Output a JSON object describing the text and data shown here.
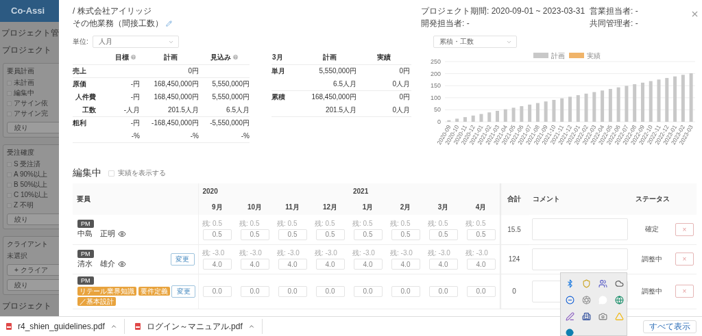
{
  "backdrop": {
    "brand": "Co-Assi",
    "breadcrumb": "プロジェクト管",
    "page_title": "プロジェクト",
    "panels": [
      {
        "title": "要員計画",
        "items": [
          {
            "label": "未計画",
            "checked": false
          },
          {
            "label": "編集中",
            "checked": false
          },
          {
            "label": "アサイン依",
            "checked": false
          },
          {
            "label": "アサイン完",
            "checked": false
          }
        ],
        "buttons": [
          "絞り"
        ]
      },
      {
        "title": "受注確度",
        "items": [
          {
            "label": "S 受注済",
            "checked": false
          },
          {
            "label": "A 90%以上",
            "checked": false
          },
          {
            "label": "B 50%以上",
            "checked": false
          },
          {
            "label": "C 10%以上",
            "checked": false
          },
          {
            "label": "Z 不明",
            "checked": false
          }
        ],
        "buttons": [
          "絞り"
        ]
      },
      {
        "title": "クライアント",
        "note": "未選択",
        "buttons": [
          "+ クライア",
          "絞り"
        ]
      }
    ],
    "footer_title": "プロジェクト"
  },
  "modal": {
    "client": "/ 株式会社アイリッジ",
    "project": "その他業務（間接工数）",
    "meta": [
      "プロジェクト期間: 2020-09-01 ~ 2023-03-31",
      "営業担当者: -",
      "開発担当者: -",
      "共同管理者: -"
    ],
    "summary": {
      "unit_label": "単位:",
      "unit": "人月",
      "columns": [
        {
          "label": "目標",
          "help": true
        },
        {
          "label": "計画",
          "help": false
        },
        {
          "label": "見込み",
          "help": true
        }
      ],
      "groups": [
        {
          "rows": [
            {
              "label": "売上",
              "plan": "0円"
            }
          ]
        },
        {
          "rows": [
            {
              "label": "原価",
              "target": "-円",
              "plan": "168,450,000円",
              "forecast": "5,550,000円",
              "children": [
                {
                  "label": "人件費",
                  "target": "-円",
                  "plan": "168,450,000円",
                  "forecast": "5,550,000円"
                },
                {
                  "label": "工数",
                  "target": "-人月",
                  "plan": "201.5人月",
                  "forecast": "6.5人月"
                }
              ]
            }
          ]
        },
        {
          "rows": [
            {
              "label": "粗利",
              "target": "-円",
              "plan": "-168,450,000円",
              "forecast": "-5,550,000円"
            },
            {
              "target": "-%",
              "plan": "-%",
              "forecast": "-%"
            }
          ]
        }
      ]
    },
    "monthly": {
      "month": "3月",
      "columns": [
        "計画",
        "実績"
      ],
      "rows": [
        {
          "label": "単月",
          "cells": [
            "5,550,000円",
            "0円"
          ]
        },
        {
          "cells": [
            "6.5人月",
            "0人月"
          ]
        },
        {
          "label": "累積",
          "cells": [
            "168,450,000円",
            "0円"
          ]
        },
        {
          "cells": [
            "201.5人月",
            "0人月"
          ]
        }
      ]
    },
    "chart": {
      "select": "累積・工数",
      "chart_data": {
        "type": "bar",
        "categories": [
          "2020-09",
          "2020-10",
          "2020-11",
          "2020-12",
          "2021-01",
          "2021-02",
          "2021-03",
          "2021-04",
          "2021-05",
          "2021-06",
          "2021-07",
          "2021-08",
          "2021-09",
          "2021-10",
          "2021-11",
          "2021-12",
          "2022-01",
          "2022-02",
          "2022-03",
          "2022-04",
          "2022-05",
          "2022-06",
          "2022-07",
          "2022-08",
          "2022-09",
          "2022-10",
          "2022-11",
          "2022-12",
          "2023-01",
          "2023-02",
          "2023-03"
        ],
        "series": [
          {
            "name": "計画",
            "color": "#c8c8c8",
            "values": [
              6.5,
              13,
              19.5,
              26,
              32.5,
              39,
              45.5,
              52,
              58.5,
              65,
              71.5,
              78,
              84.5,
              91,
              97.5,
              104,
              110.5,
              117,
              123.5,
              130,
              136.5,
              143,
              149.5,
              156,
              162.5,
              169,
              175.5,
              182,
              188.5,
              195,
              201.5
            ]
          },
          {
            "name": "実績",
            "color": "#f0b46a",
            "values": [
              0,
              0,
              0,
              0,
              0,
              0,
              0,
              0,
              0,
              0,
              0,
              0,
              0,
              0,
              0,
              0,
              0,
              0,
              0,
              0,
              0,
              0,
              0,
              0,
              0,
              0,
              0,
              0,
              0,
              0,
              0
            ]
          }
        ],
        "ylim": [
          0,
          250
        ],
        "yticks": [
          0,
          50,
          100,
          150,
          200,
          250
        ],
        "grid": true
      }
    },
    "plan": {
      "title": "編集中",
      "show_actual": {
        "label": "実績を表示する",
        "checked": false
      },
      "member_header": "要員",
      "years": [
        {
          "label": "2020",
          "months": [
            "9月",
            "10月",
            "11月",
            "12月"
          ]
        },
        {
          "label": "2021",
          "months": [
            "1月",
            "2月",
            "3月",
            "4月"
          ]
        }
      ],
      "total_header": "合計",
      "comment_header": "コメント",
      "status_header": "ステータス",
      "rows": [
        {
          "role": "PM",
          "name": "中島　正明",
          "watching": true,
          "remaining": [
            "残: 0.5",
            "残: 0.5",
            "残: 0.5",
            "残: 0.5",
            "残: 0.5",
            "残: 0.5",
            "残: 0.5",
            "残: 0.5"
          ],
          "values": [
            "0.5",
            "0.5",
            "0.5",
            "0.5",
            "0.5",
            "0.5",
            "0.5",
            "0.5"
          ],
          "total": "15.5",
          "status": "確定",
          "delete": "×"
        },
        {
          "role": "PM",
          "name": "清水　雄介",
          "watching": true,
          "change": "変更",
          "remaining": [
            "残: -3.0",
            "残: -3.0",
            "残: -3.0",
            "残: -3.0",
            "残: -3.0",
            "残: -3.0",
            "残: -3.0",
            "残: -3.0"
          ],
          "values": [
            "4.0",
            "4.0",
            "4.0",
            "4.0",
            "4.0",
            "4.0",
            "4.0",
            "4.0"
          ],
          "total": "124",
          "status": "調整中",
          "delete": "×"
        },
        {
          "role": "PM",
          "skills": [
            "リテール業界知識",
            "要件定義／基本設計"
          ],
          "change": "変更",
          "values": [
            "0.0",
            "0.0",
            "0.0",
            "0.0",
            "0.0",
            "0.0",
            "0.0",
            "0.0"
          ],
          "total": "0",
          "status": "調整中",
          "delete": "×"
        }
      ]
    }
  },
  "downloads": {
    "files": [
      {
        "name": "r4_shien_guidelines.pdf"
      },
      {
        "name": "ログイン～マニュアル.pdf"
      }
    ],
    "show_all": "すべて表示"
  }
}
